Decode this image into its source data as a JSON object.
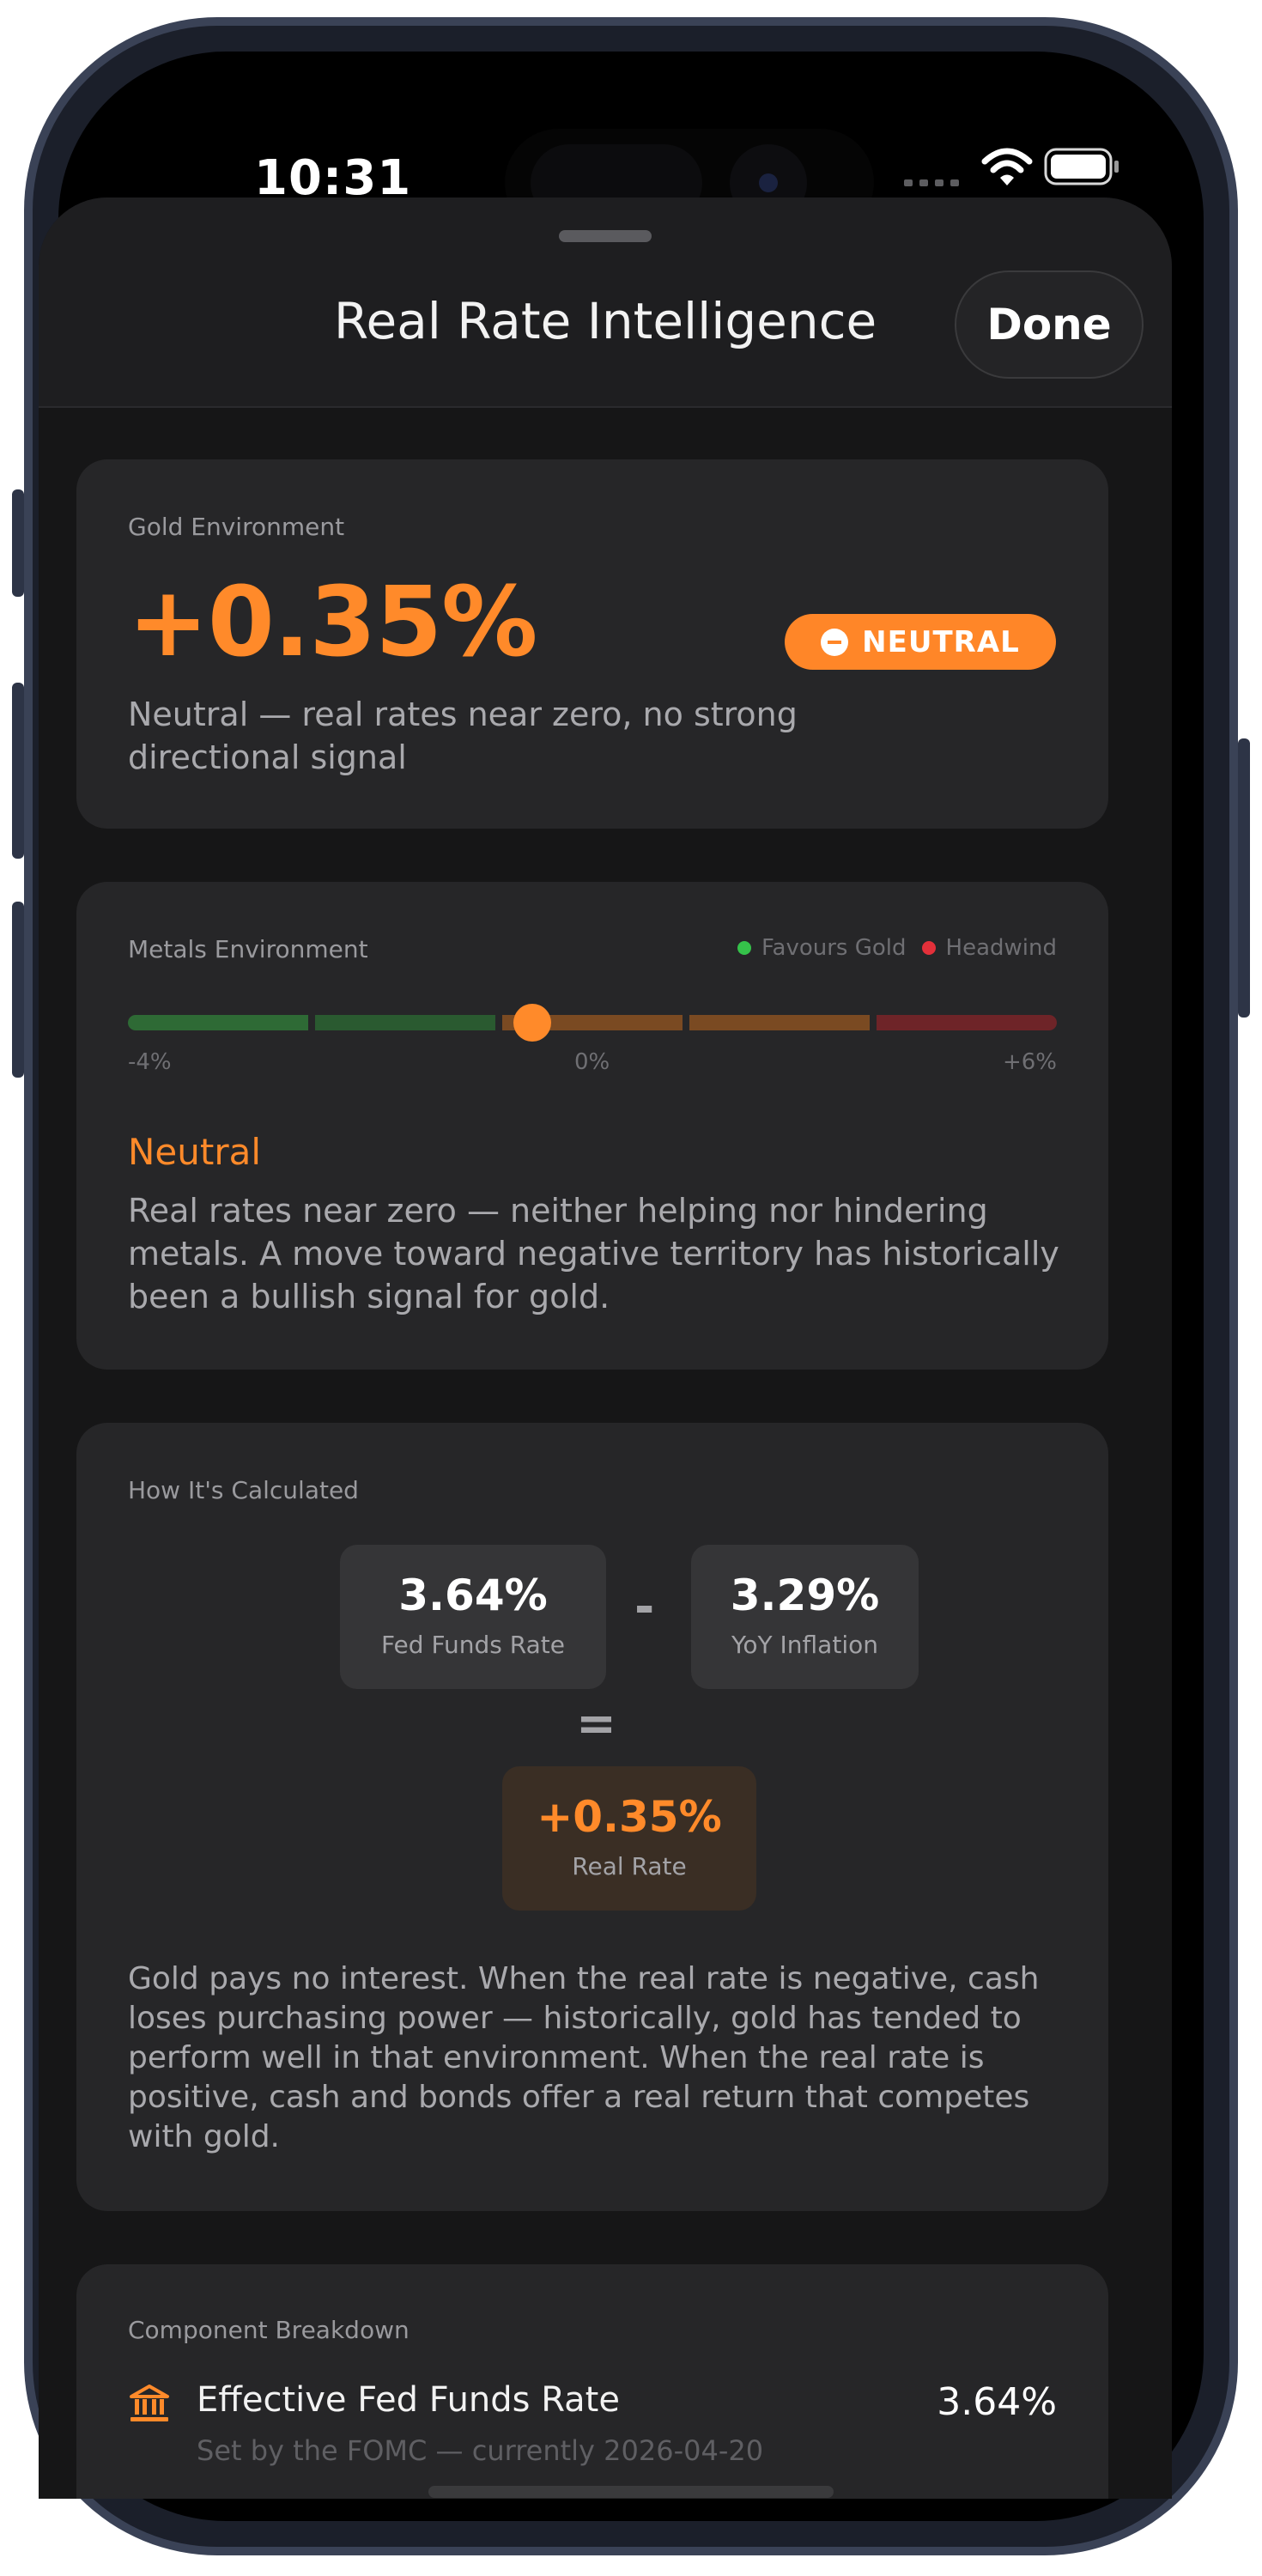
{
  "status": {
    "time": "10:31"
  },
  "header": {
    "title": "Real Rate Intelligence",
    "done_label": "Done"
  },
  "gold_env": {
    "label": "Gold Environment",
    "value": "+0.35%",
    "badge": "NEUTRAL",
    "desc_line1": "Neutral — real rates near zero, no strong",
    "desc_line2": "directional signal"
  },
  "metals_env": {
    "label": "Metals Environment",
    "legend_favours": "Favours Gold",
    "legend_headwind": "Headwind",
    "tick_left": "-4%",
    "tick_mid": "0%",
    "tick_right": "+6%",
    "gauge_min": -4,
    "gauge_max": 6,
    "gauge_value": 0.35,
    "status": "Neutral",
    "desc_line1": "Real rates near zero — neither helping nor hindering",
    "desc_line2": "metals. A move toward negative territory has historically",
    "desc_line3": "been a bullish signal for gold."
  },
  "calc": {
    "label": "How It's Calculated",
    "fed_value": "3.64%",
    "fed_label": "Fed Funds Rate",
    "minus": "-",
    "infl_value": "3.29%",
    "infl_label": "YoY Inflation",
    "equals": "=",
    "real_value": "+0.35%",
    "real_label": "Real Rate",
    "desc_line1": "Gold pays no interest. When the real rate is negative, cash",
    "desc_line2": "loses purchasing power — historically, gold has tended to",
    "desc_line3": "perform well in that environment. When the real rate is",
    "desc_line4": "positive, cash and bonds offer a real return that competes",
    "desc_line5": "with gold."
  },
  "breakdown": {
    "label": "Component Breakdown",
    "row1_title": "Effective Fed Funds Rate",
    "row1_sub": "Set by the FOMC — currently 2026-04-20",
    "row1_value": "3.64%"
  },
  "colors": {
    "accent": "#ff8a2a",
    "favours": "#35c24a",
    "headwind": "#e3303a"
  }
}
